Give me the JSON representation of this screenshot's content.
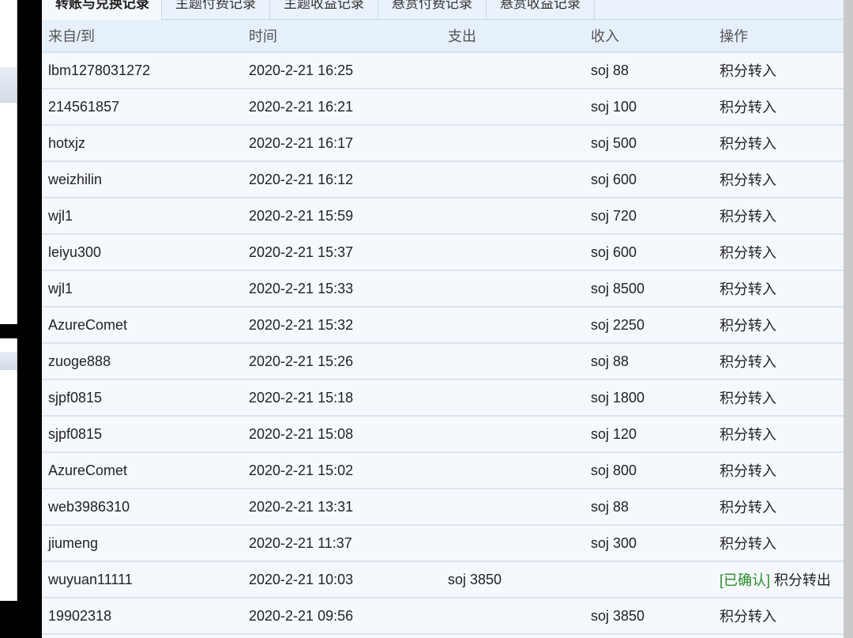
{
  "tabs": [
    "转账与兑换记录",
    "主题付费记录",
    "主题收益记录",
    "悬赏付费记录",
    "悬赏收益记录"
  ],
  "columns": [
    "来自/到",
    "时间",
    "支出",
    "收入",
    "操作"
  ],
  "rows": [
    {
      "from": "lbm1278031272",
      "time": "2020-2-21 16:25",
      "out": "",
      "in": "soj 88",
      "status": "",
      "op": "积分转入"
    },
    {
      "from": "214561857",
      "time": "2020-2-21 16:21",
      "out": "",
      "in": "soj 100",
      "status": "",
      "op": "积分转入"
    },
    {
      "from": "hotxjz",
      "time": "2020-2-21 16:17",
      "out": "",
      "in": "soj 500",
      "status": "",
      "op": "积分转入"
    },
    {
      "from": "weizhilin",
      "time": "2020-2-21 16:12",
      "out": "",
      "in": "soj 600",
      "status": "",
      "op": "积分转入"
    },
    {
      "from": "wjl1",
      "time": "2020-2-21 15:59",
      "out": "",
      "in": "soj 720",
      "status": "",
      "op": "积分转入"
    },
    {
      "from": "leiyu300",
      "time": "2020-2-21 15:37",
      "out": "",
      "in": "soj 600",
      "status": "",
      "op": "积分转入"
    },
    {
      "from": "wjl1",
      "time": "2020-2-21 15:33",
      "out": "",
      "in": "soj 8500",
      "status": "",
      "op": "积分转入"
    },
    {
      "from": "AzureComet",
      "time": "2020-2-21 15:32",
      "out": "",
      "in": "soj 2250",
      "status": "",
      "op": "积分转入"
    },
    {
      "from": "zuoge888",
      "time": "2020-2-21 15:26",
      "out": "",
      "in": "soj 88",
      "status": "",
      "op": "积分转入"
    },
    {
      "from": "sjpf0815",
      "time": "2020-2-21 15:18",
      "out": "",
      "in": "soj 1800",
      "status": "",
      "op": "积分转入"
    },
    {
      "from": "sjpf0815",
      "time": "2020-2-21 15:08",
      "out": "",
      "in": "soj 120",
      "status": "",
      "op": "积分转入"
    },
    {
      "from": "AzureComet",
      "time": "2020-2-21 15:02",
      "out": "",
      "in": "soj 800",
      "status": "",
      "op": "积分转入"
    },
    {
      "from": "web3986310",
      "time": "2020-2-21 13:31",
      "out": "",
      "in": "soj 88",
      "status": "",
      "op": "积分转入"
    },
    {
      "from": "jiumeng",
      "time": "2020-2-21 11:37",
      "out": "",
      "in": "soj 300",
      "status": "",
      "op": "积分转入"
    },
    {
      "from": "wuyuan11111",
      "time": "2020-2-21 10:03",
      "out": "soj 3850",
      "in": "",
      "status": "[已确认]",
      "op": "积分转出"
    },
    {
      "from": "19902318",
      "time": "2020-2-21 09:56",
      "out": "",
      "in": "soj 3850",
      "status": "",
      "op": "积分转入"
    }
  ],
  "colors": {
    "confirmed": "#2a8a2a",
    "header_bg": "#e6f0fb"
  }
}
